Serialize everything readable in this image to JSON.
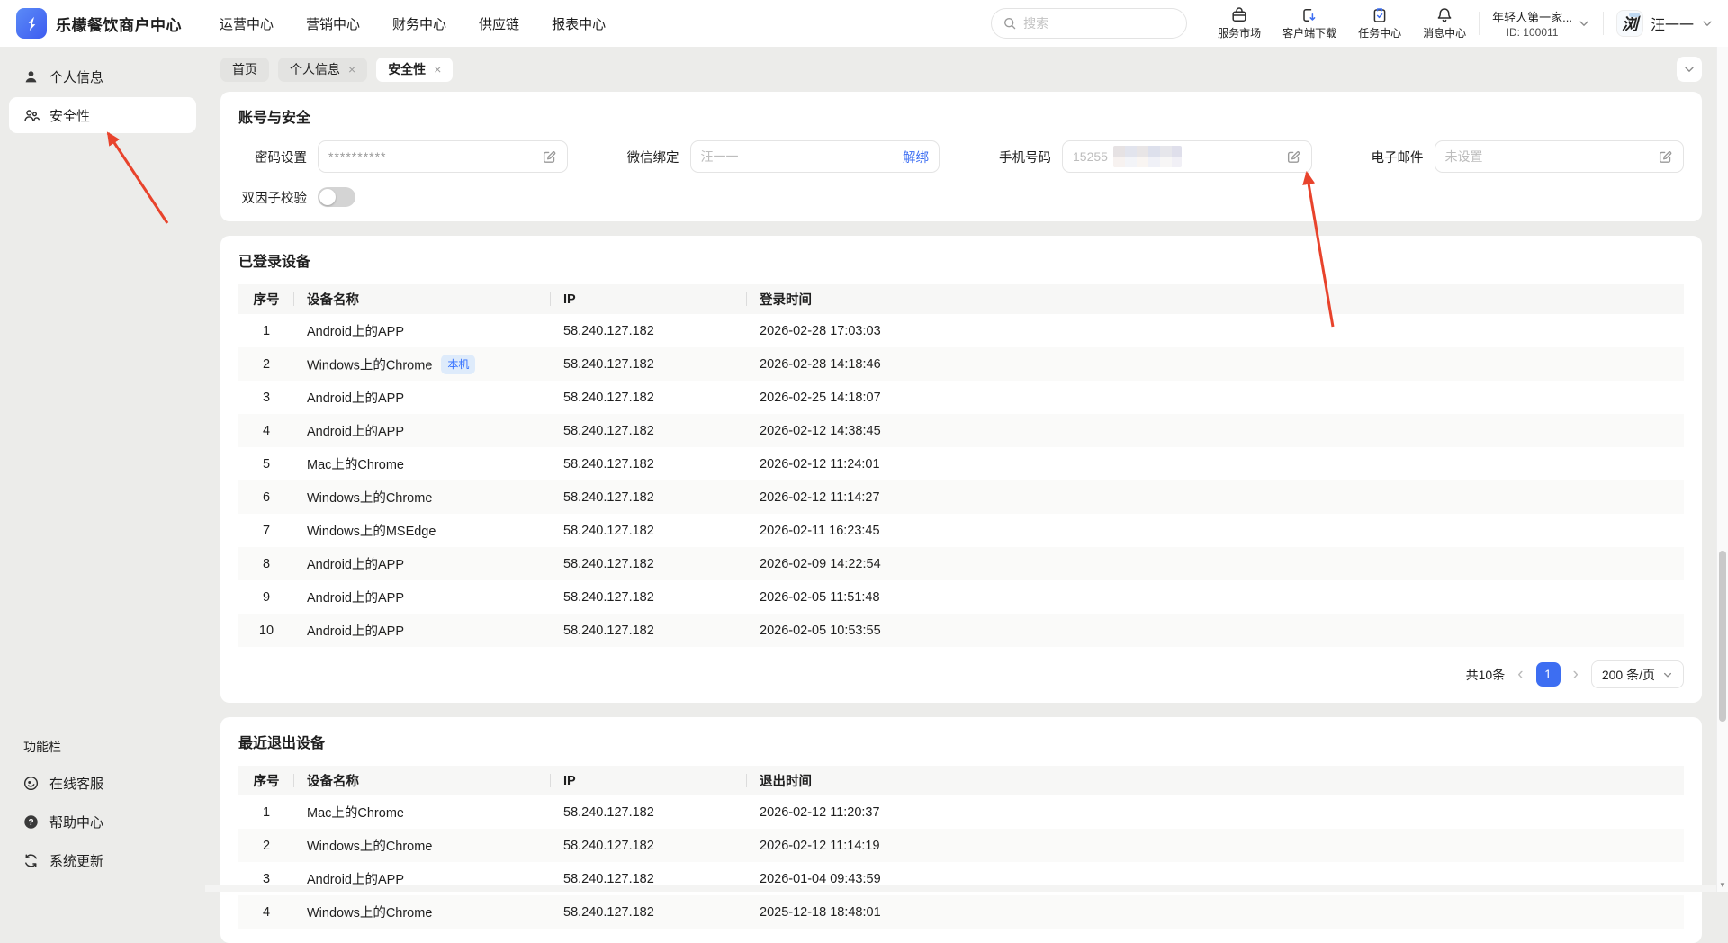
{
  "topbar": {
    "brand": "乐檬餐饮商户中心",
    "nav_items": [
      "运营中心",
      "营销中心",
      "财务中心",
      "供应链",
      "报表中心"
    ],
    "search": {
      "placeholder": "搜索"
    },
    "quick_actions": [
      {
        "name": "service-market",
        "icon": "market-icon",
        "label": "服务市场"
      },
      {
        "name": "client-download",
        "icon": "download-icon",
        "label": "客户端下载"
      },
      {
        "name": "task-center",
        "icon": "task-icon",
        "label": "任务中心"
      },
      {
        "name": "message-center",
        "icon": "bell-icon",
        "label": "消息中心"
      }
    ],
    "store": {
      "name": "年轻人第一家...",
      "id": "ID: 100011"
    },
    "user": {
      "name": "汪一一",
      "avatar_char": "浏"
    }
  },
  "sidebar": {
    "items": [
      {
        "name": "profile",
        "icon": "person-icon",
        "label": "个人信息",
        "active": false
      },
      {
        "name": "security",
        "icon": "security-icon",
        "label": "安全性",
        "active": true
      }
    ],
    "footer_title": "功能栏",
    "footer_items": [
      {
        "name": "online-service",
        "icon": "service-icon",
        "label": "在线客服"
      },
      {
        "name": "help-center",
        "icon": "help-icon",
        "label": "帮助中心"
      },
      {
        "name": "system-update",
        "icon": "update-icon",
        "label": "系统更新"
      }
    ]
  },
  "tabs": [
    {
      "name": "home",
      "label": "首页",
      "closable": false,
      "active": false
    },
    {
      "name": "profile",
      "label": "个人信息",
      "closable": true,
      "active": false
    },
    {
      "name": "security",
      "label": "安全性",
      "closable": true,
      "active": true
    }
  ],
  "account": {
    "title": "账号与安全",
    "password_label": "密码设置",
    "password_value": "**********",
    "wechat_label": "微信绑定",
    "wechat_value": "汪一一",
    "wechat_action": "解绑",
    "phone_label": "手机号码",
    "phone_value": "15255",
    "email_label": "电子邮件",
    "email_placeholder": "未设置",
    "two_factor_label": "双因子校验",
    "two_factor_enabled": false
  },
  "logged_in": {
    "title": "已登录设备",
    "columns": [
      "序号",
      "设备名称",
      "IP",
      "登录时间"
    ],
    "rows": [
      {
        "no": "1",
        "device": "Android上的APP",
        "ip": "58.240.127.182",
        "time": "2026-02-28 17:03:03"
      },
      {
        "no": "2",
        "device": "Windows上的Chrome",
        "badge": "本机",
        "ip": "58.240.127.182",
        "time": "2026-02-28 14:18:46"
      },
      {
        "no": "3",
        "device": "Android上的APP",
        "ip": "58.240.127.182",
        "time": "2026-02-25 14:18:07"
      },
      {
        "no": "4",
        "device": "Android上的APP",
        "ip": "58.240.127.182",
        "time": "2026-02-12 14:38:45"
      },
      {
        "no": "5",
        "device": "Mac上的Chrome",
        "ip": "58.240.127.182",
        "time": "2026-02-12 11:24:01"
      },
      {
        "no": "6",
        "device": "Windows上的Chrome",
        "ip": "58.240.127.182",
        "time": "2026-02-12 11:14:27"
      },
      {
        "no": "7",
        "device": "Windows上的MSEdge",
        "ip": "58.240.127.182",
        "time": "2026-02-11 16:23:45"
      },
      {
        "no": "8",
        "device": "Android上的APP",
        "ip": "58.240.127.182",
        "time": "2026-02-09 14:22:54"
      },
      {
        "no": "9",
        "device": "Android上的APP",
        "ip": "58.240.127.182",
        "time": "2026-02-05 11:51:48"
      },
      {
        "no": "10",
        "device": "Android上的APP",
        "ip": "58.240.127.182",
        "time": "2026-02-05 10:53:55"
      }
    ],
    "pagination": {
      "total": "共10条",
      "page": "1",
      "page_size": "200 条/页"
    }
  },
  "logged_out": {
    "title": "最近退出设备",
    "columns": [
      "序号",
      "设备名称",
      "IP",
      "退出时间"
    ],
    "rows": [
      {
        "no": "1",
        "device": "Mac上的Chrome",
        "ip": "58.240.127.182",
        "time": "2026-02-12 11:20:37"
      },
      {
        "no": "2",
        "device": "Windows上的Chrome",
        "ip": "58.240.127.182",
        "time": "2026-02-12 11:14:19"
      },
      {
        "no": "3",
        "device": "Android上的APP",
        "ip": "58.240.127.182",
        "time": "2026-01-04 09:43:59"
      },
      {
        "no": "4",
        "device": "Windows上的Chrome",
        "ip": "58.240.127.182",
        "time": "2025-12-18 18:48:01"
      }
    ]
  },
  "colors": {
    "accent": "#3D6EF2",
    "arrow": "#E8432C",
    "badge_bg": "#DEEBFB",
    "badge_text": "#3370FF"
  }
}
